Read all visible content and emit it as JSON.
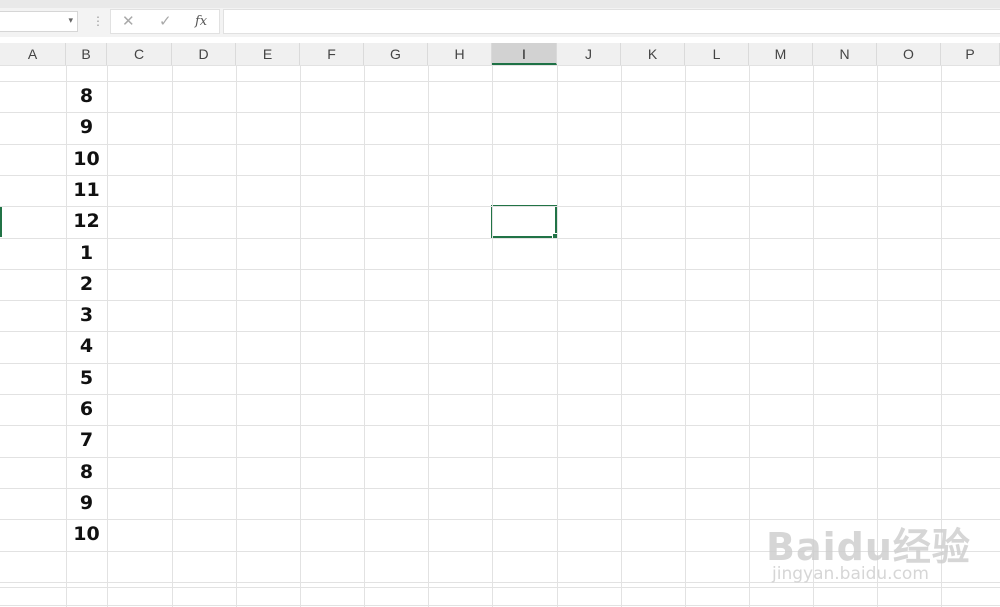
{
  "formula_bar": {
    "name_box_value": "",
    "cancel_icon": "✕",
    "enter_icon": "✓",
    "function_icon": "fx",
    "formula_value": ""
  },
  "columns": [
    "A",
    "B",
    "C",
    "D",
    "E",
    "F",
    "G",
    "H",
    "I",
    "J",
    "K",
    "L",
    "M",
    "N",
    "O",
    "P"
  ],
  "selected_column": "I",
  "column_b_values": [
    "8",
    "9",
    "10",
    "11",
    "12",
    "1",
    "2",
    "3",
    "4",
    "5",
    "6",
    "7",
    "8",
    "9",
    "10"
  ],
  "watermark": {
    "brand": "Baidu经验",
    "url": "jingyan.baidu.com"
  },
  "colors": {
    "accent": "#217346",
    "gridline": "#e2e2e2",
    "header_bg": "#f0f0f0"
  }
}
